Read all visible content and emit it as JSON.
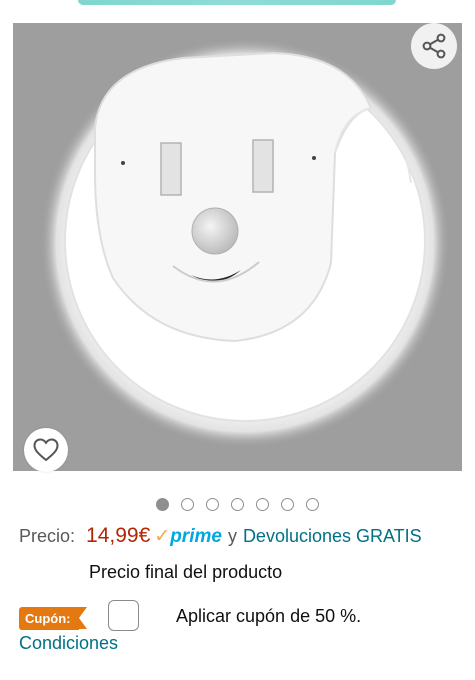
{
  "gallery": {
    "image_alt": "Luz nocturna LED con sensor de movimiento",
    "image_count": 7,
    "active_index": 0,
    "share_icon": "share-icon",
    "favorite_icon": "heart-icon"
  },
  "price": {
    "label": "Precio:",
    "value": "14,99€",
    "prime_check": "✓",
    "prime_word": "prime",
    "connector": "y",
    "returns_link": "Devoluciones GRATIS",
    "final_note": "Precio final del producto"
  },
  "coupon": {
    "badge": "Cupón:",
    "checked": false,
    "text": "Aplicar cupón de 50 %.",
    "conditions_link": "Condiciones"
  },
  "colors": {
    "price": "#b12704",
    "link": "#007185",
    "coupon_badge": "#e47911",
    "prime_blue": "#00a8e1",
    "prime_check": "#f3a847"
  }
}
